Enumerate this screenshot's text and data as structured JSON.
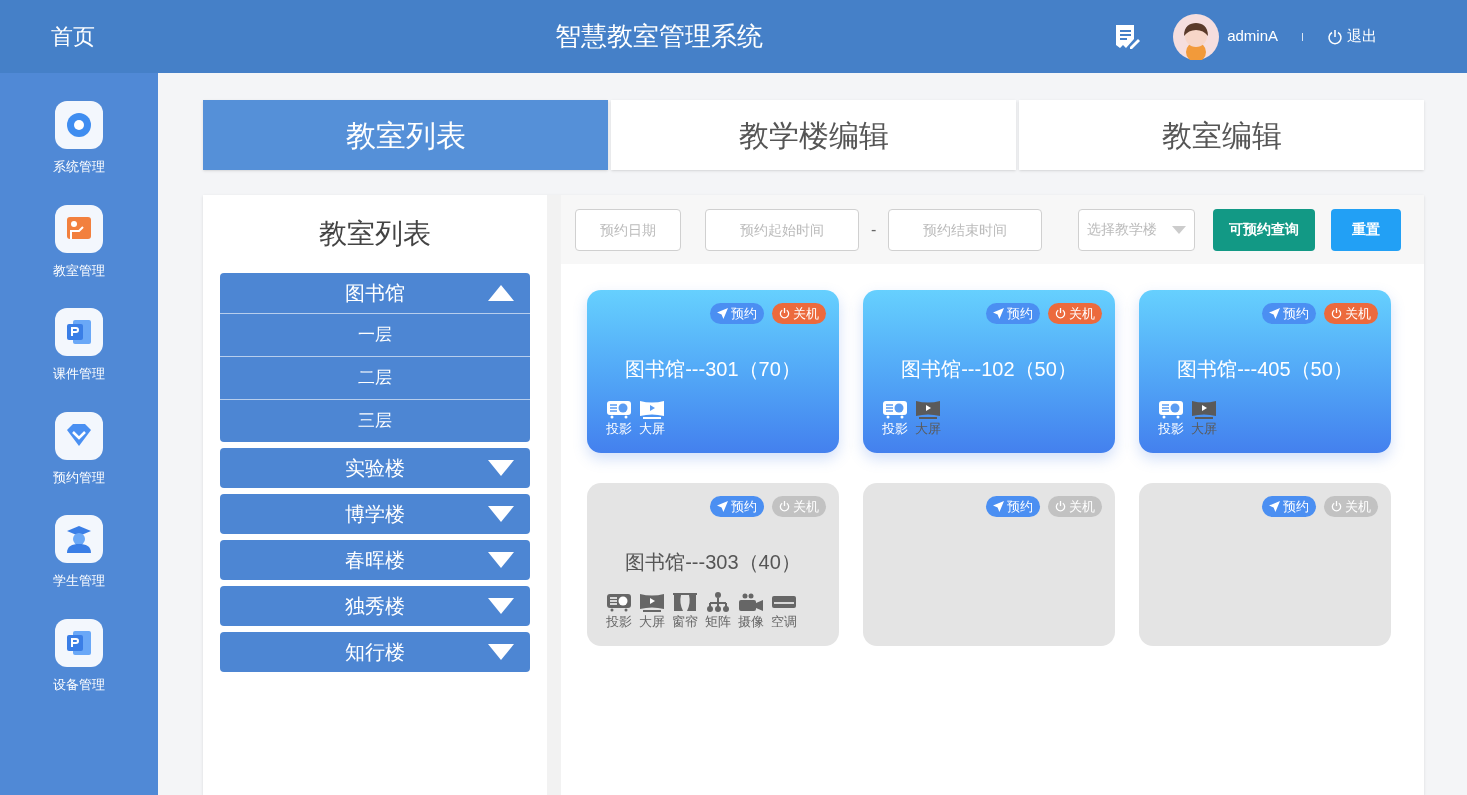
{
  "header": {
    "home": "首页",
    "title": "智慧教室管理系统",
    "user": "adminA",
    "logout": "退出"
  },
  "nav": [
    {
      "kind": "gear",
      "label": "系统管理"
    },
    {
      "kind": "classroom",
      "label": "教室管理"
    },
    {
      "kind": "document",
      "label": "课件管理"
    },
    {
      "kind": "diamond",
      "label": "预约管理"
    },
    {
      "kind": "graduate",
      "label": "学生管理"
    },
    {
      "kind": "document",
      "label": "设备管理"
    }
  ],
  "tabs": [
    {
      "label": "教室列表",
      "selected": true
    },
    {
      "label": "教学楼编辑",
      "selected": false
    },
    {
      "label": "教室编辑",
      "selected": false
    }
  ],
  "tree": {
    "title": "教室列表",
    "buildings": [
      {
        "label": "图书馆",
        "expanded": true,
        "children": [
          {
            "label": "一层"
          },
          {
            "label": "二层"
          },
          {
            "label": "三层"
          }
        ]
      },
      {
        "label": "实验楼",
        "expanded": false
      },
      {
        "label": "博学楼",
        "expanded": false
      },
      {
        "label": "春晖楼",
        "expanded": false
      },
      {
        "label": "独秀楼",
        "expanded": false
      },
      {
        "label": "知行楼",
        "expanded": false
      }
    ]
  },
  "filters": {
    "date": {
      "placeholder": "预约日期"
    },
    "start": {
      "placeholder": "预约起始时间"
    },
    "separator": "-",
    "end": {
      "placeholder": "预约结束时间"
    },
    "building": {
      "placeholder": "选择教学楼"
    },
    "query_button": "可预约查询",
    "reset_button": "重置"
  },
  "rooms": [
    {
      "active": true,
      "reserve": "预约",
      "power": "关机",
      "power_on": true,
      "title": "图书馆---301（70）",
      "equipment": [
        {
          "kind": "projector",
          "label": "投影",
          "available": true
        },
        {
          "kind": "screen",
          "label": "大屏",
          "available": true
        }
      ]
    },
    {
      "active": true,
      "reserve": "预约",
      "power": "关机",
      "power_on": true,
      "title": "图书馆---102（50）",
      "equipment": [
        {
          "kind": "projector",
          "label": "投影",
          "available": true
        },
        {
          "kind": "screen",
          "label": "大屏",
          "available": false
        }
      ]
    },
    {
      "active": true,
      "reserve": "预约",
      "power": "关机",
      "power_on": true,
      "title": "图书馆---405（50）",
      "equipment": [
        {
          "kind": "projector",
          "label": "投影",
          "available": true
        },
        {
          "kind": "screen",
          "label": "大屏",
          "available": false
        }
      ]
    },
    {
      "active": false,
      "reserve": "预约",
      "power": "关机",
      "power_on": false,
      "title": "图书馆---303（40）",
      "equipment": [
        {
          "kind": "projector",
          "label": "投影",
          "available": true
        },
        {
          "kind": "screen",
          "label": "大屏",
          "available": true
        },
        {
          "kind": "curtain",
          "label": "窗帘",
          "available": true
        },
        {
          "kind": "matrix",
          "label": "矩阵",
          "available": true
        },
        {
          "kind": "camera",
          "label": "摄像",
          "available": true
        },
        {
          "kind": "aircon",
          "label": "空调",
          "available": true
        }
      ]
    },
    {
      "active": false,
      "reserve": "预约",
      "power": "关机",
      "power_on": false
    },
    {
      "active": false,
      "reserve": "预约",
      "power": "关机",
      "power_on": false
    }
  ]
}
